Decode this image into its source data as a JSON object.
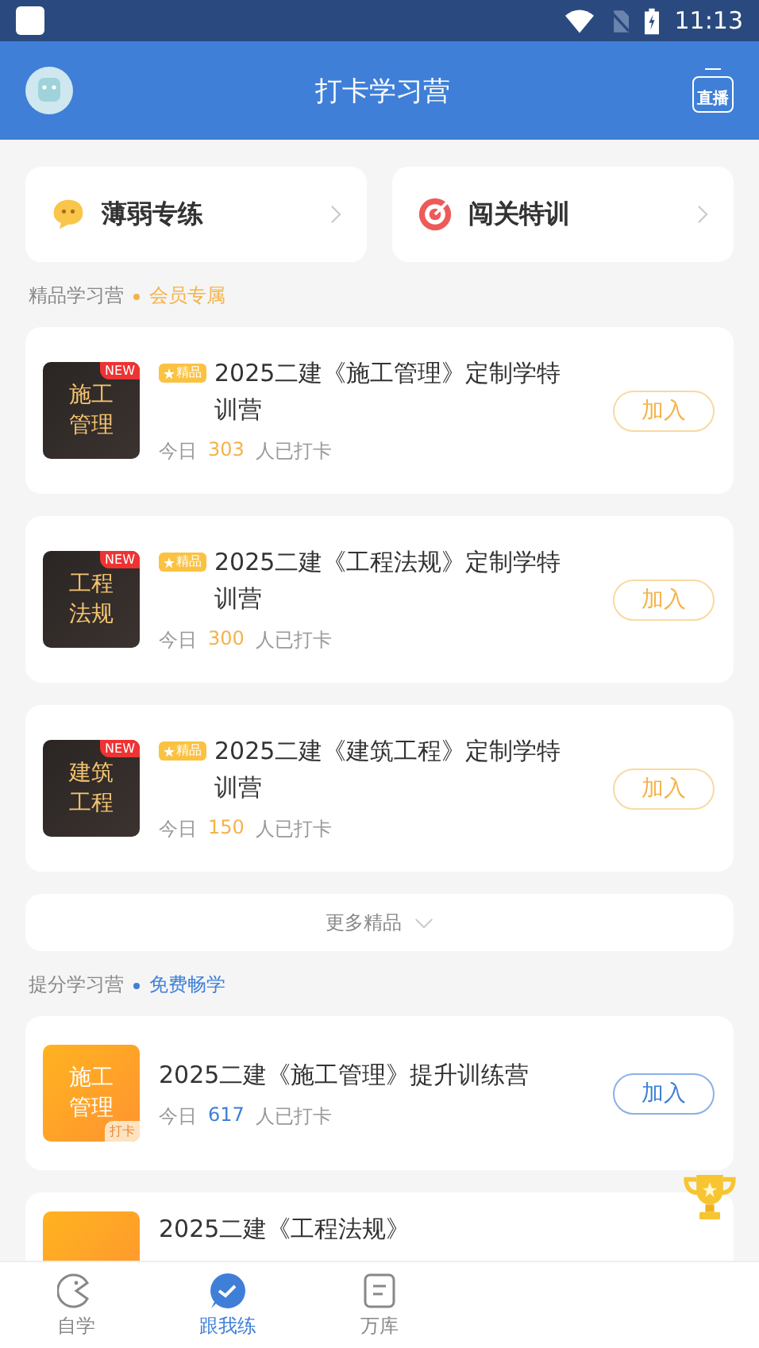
{
  "status_bar": {
    "time": "11:13"
  },
  "header": {
    "title": "打卡学习营",
    "live_label": "直播"
  },
  "quick_links": [
    {
      "kind": "chat",
      "label": "薄弱专练"
    },
    {
      "kind": "target",
      "label": "闯关特训"
    }
  ],
  "sections": [
    {
      "kind": "premium",
      "title": "精品学习营",
      "tag": "会员专属",
      "more": "更多精品",
      "items": [
        {
          "thumb": "施工管理",
          "new": "NEW",
          "badge": "精品",
          "title": "2025二建《施工管理》定制学特训营",
          "prefix": "今日",
          "count": "303",
          "suffix": "人已打卡",
          "button": "加入"
        },
        {
          "thumb": "工程法规",
          "new": "NEW",
          "badge": "精品",
          "title": "2025二建《工程法规》定制学特训营",
          "prefix": "今日",
          "count": "300",
          "suffix": "人已打卡",
          "button": "加入"
        },
        {
          "thumb": "建筑工程",
          "new": "NEW",
          "badge": "精品",
          "title": "2025二建《建筑工程》定制学特训营",
          "prefix": "今日",
          "count": "150",
          "suffix": "人已打卡",
          "button": "加入"
        }
      ]
    },
    {
      "kind": "free",
      "title": "提分学习营",
      "tag": "免费畅学",
      "items": [
        {
          "thumb": "施工管理",
          "corner": "打卡",
          "title": "2025二建《施工管理》提升训练营",
          "prefix": "今日",
          "count": "617",
          "suffix": "人已打卡",
          "button": "加入"
        },
        {
          "title": "2025二建《工程法规》"
        }
      ]
    }
  ],
  "bottom_nav": [
    {
      "kind": "self",
      "label": "自学",
      "selected": false
    },
    {
      "kind": "practice",
      "label": "跟我练",
      "selected": true
    },
    {
      "kind": "bank",
      "label": "万库",
      "selected": false
    }
  ]
}
